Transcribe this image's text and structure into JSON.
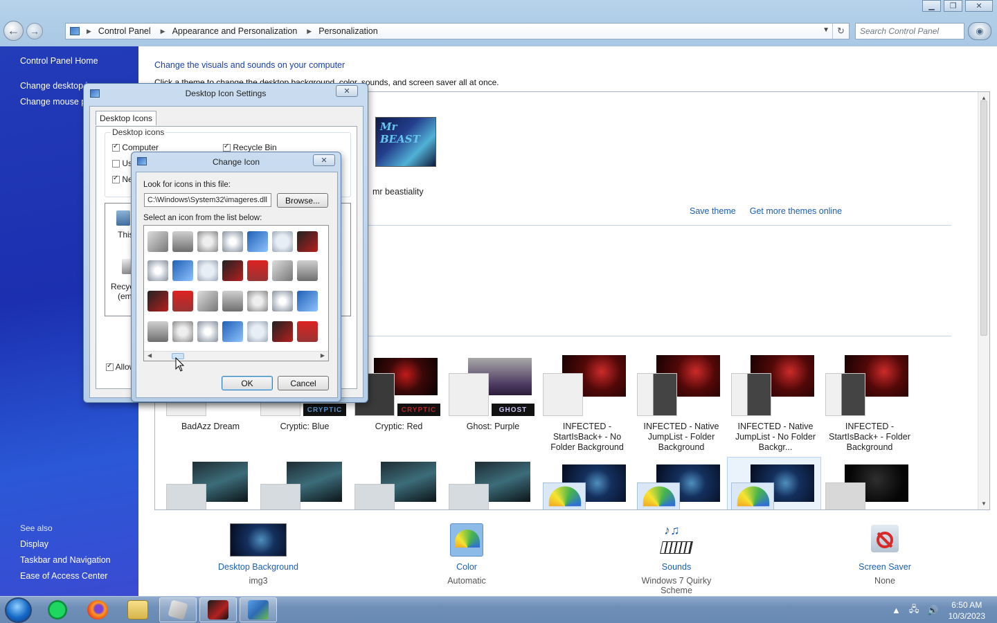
{
  "window": {
    "breadcrumbs": [
      "Control Panel",
      "Appearance and Personalization",
      "Personalization"
    ],
    "search_placeholder": "Search Control Panel"
  },
  "sidebar": {
    "home": "Control Panel Home",
    "links": [
      "Change desktop i",
      "Change mouse p"
    ],
    "see_also_header": "See also",
    "see_also": [
      "Display",
      "Taskbar and Navigation",
      "Ease of Access Center"
    ]
  },
  "main": {
    "title": "Change the visuals and sounds on your computer",
    "subtitle": "Click a theme to change the desktop background, color, sounds, and screen saver all at once.",
    "my_theme_label": "mr beastiality",
    "my_theme_art_text": "Mr BEAST",
    "save_theme": "Save theme",
    "get_more_themes": "Get more themes online",
    "themes_row1": [
      {
        "label": "BadAzz Dream",
        "badge": ""
      },
      {
        "label": "Cryptic: Blue",
        "badge": "CRYPTIC"
      },
      {
        "label": "Cryptic: Red",
        "badge": "CRYPTIC"
      },
      {
        "label": "Ghost: Purple",
        "badge": "GHOST"
      },
      {
        "label": "INFECTED - StartIsBack+ - No Folder Background"
      },
      {
        "label": "INFECTED - Native JumpList - Folder Background"
      },
      {
        "label": "INFECTED - Native JumpList - No Folder Backgr..."
      },
      {
        "label": "INFECTED - StartIsBack+ - Folder Background"
      }
    ]
  },
  "settings": {
    "desktop_background": {
      "label": "Desktop Background",
      "value": "img3"
    },
    "color": {
      "label": "Color",
      "value": "Automatic"
    },
    "sounds": {
      "label": "Sounds",
      "value": "Windows 7 Quirky Scheme"
    },
    "screen_saver": {
      "label": "Screen Saver",
      "value": "None"
    }
  },
  "desktop_icon_dialog": {
    "title": "Desktop Icon Settings",
    "tab": "Desktop Icons",
    "group": "Desktop icons",
    "checks": [
      {
        "label": "Computer",
        "checked": true
      },
      {
        "label": "Recycle Bin",
        "checked": true
      },
      {
        "label": "Us",
        "checked": false
      },
      {
        "label": "Ne",
        "checked": true
      }
    ],
    "preview_labels": [
      "This",
      "Recyc",
      "(em"
    ],
    "allow_label": "Allow"
  },
  "change_icon_dialog": {
    "title": "Change Icon",
    "file_label": "Look for icons in this file:",
    "file_path": "C:\\Windows\\System32\\imageres.dll",
    "browse": "Browse...",
    "list_label": "Select an icon from the list below:",
    "ok": "OK",
    "cancel": "Cancel"
  },
  "taskbar": {
    "time": "6:50 AM",
    "date": "10/3/2023"
  },
  "colors": {
    "link": "#1a5fb4",
    "sidebar": "#1b2fb0",
    "accent": "#3c7fb1"
  }
}
